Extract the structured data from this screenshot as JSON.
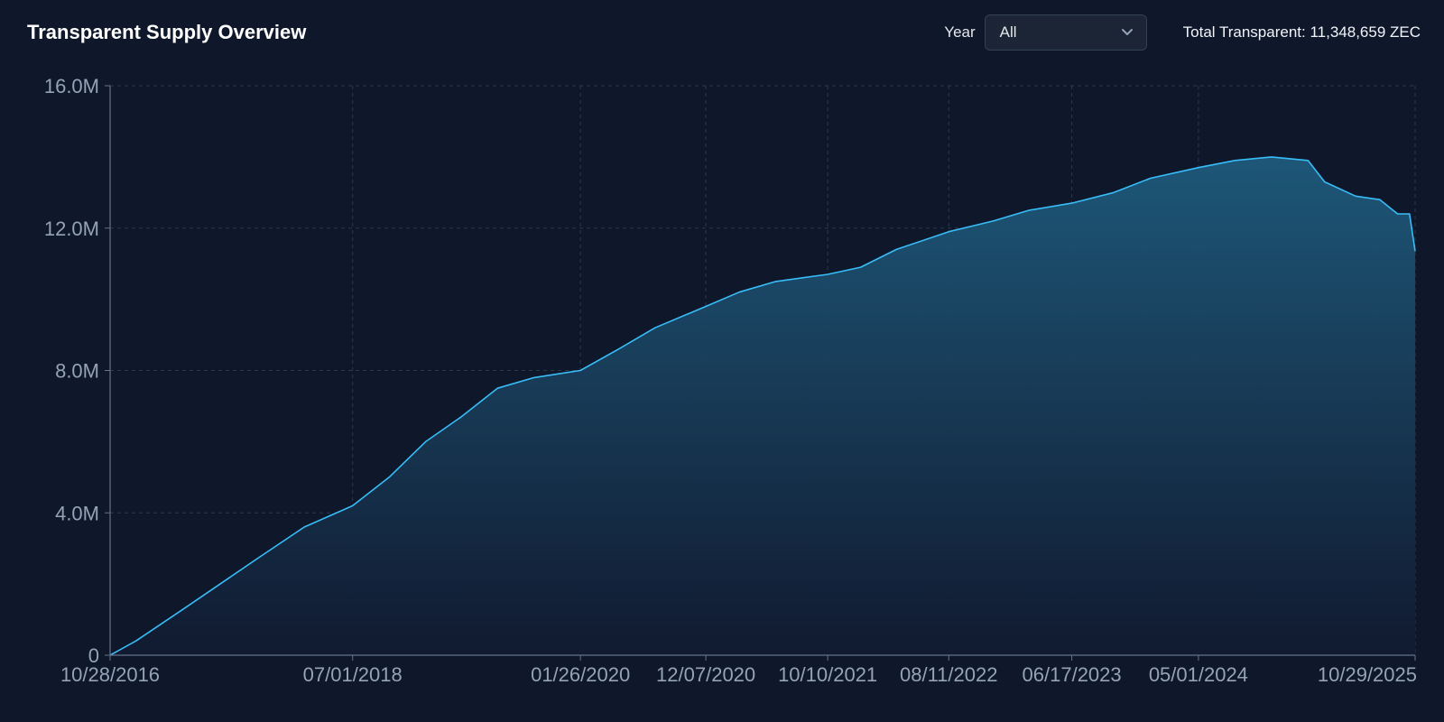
{
  "header": {
    "title": "Transparent Supply Overview",
    "year_label": "Year",
    "year_selected": "All",
    "total_text": "Total Transparent: 11,348,659 ZEC",
    "chevron_icon": "chevron-down-icon"
  },
  "colors": {
    "background": "#0f172a",
    "line": "#38bdf8",
    "area_top": "#1e5a7c",
    "area_bottom": "#111a30",
    "grid": "#334155",
    "tick_text": "#94a3b8"
  },
  "chart_data": {
    "type": "area",
    "title": "",
    "xlabel": "",
    "ylabel": "",
    "ylim": [
      0,
      16000000
    ],
    "x_range": [
      "2016-10-28",
      "2025-10-29"
    ],
    "y_ticks": [
      {
        "value": 0,
        "label": "0"
      },
      {
        "value": 4000000,
        "label": "4.0M"
      },
      {
        "value": 8000000,
        "label": "8.0M"
      },
      {
        "value": 12000000,
        "label": "12.0M"
      },
      {
        "value": 16000000,
        "label": "16.0M"
      }
    ],
    "x_ticks": [
      {
        "value": "2016-10-28",
        "label": "10/28/2016"
      },
      {
        "value": "2018-07-01",
        "label": "07/01/2018"
      },
      {
        "value": "2020-01-26",
        "label": "01/26/2020"
      },
      {
        "value": "2020-12-07",
        "label": "12/07/2020"
      },
      {
        "value": "2021-10-10",
        "label": "10/10/2021"
      },
      {
        "value": "2022-08-11",
        "label": "08/11/2022"
      },
      {
        "value": "2023-06-17",
        "label": "06/17/2023"
      },
      {
        "value": "2024-05-01",
        "label": "05/01/2024"
      },
      {
        "value": "2025-10-29",
        "label": "10/29/2025"
      }
    ],
    "grid": true,
    "series": [
      {
        "name": "",
        "points": [
          {
            "x": "2016-10-28",
            "y": 0
          },
          {
            "x": "2017-01-01",
            "y": 400000
          },
          {
            "x": "2017-05-01",
            "y": 1300000
          },
          {
            "x": "2017-11-01",
            "y": 2700000
          },
          {
            "x": "2018-03-01",
            "y": 3600000
          },
          {
            "x": "2018-07-01",
            "y": 4200000
          },
          {
            "x": "2018-10-01",
            "y": 5000000
          },
          {
            "x": "2019-01-01",
            "y": 6000000
          },
          {
            "x": "2019-04-01",
            "y": 6700000
          },
          {
            "x": "2019-07-01",
            "y": 7500000
          },
          {
            "x": "2019-10-01",
            "y": 7800000
          },
          {
            "x": "2020-01-26",
            "y": 8000000
          },
          {
            "x": "2020-05-01",
            "y": 8600000
          },
          {
            "x": "2020-08-01",
            "y": 9200000
          },
          {
            "x": "2020-12-07",
            "y": 9800000
          },
          {
            "x": "2021-03-01",
            "y": 10200000
          },
          {
            "x": "2021-06-01",
            "y": 10500000
          },
          {
            "x": "2021-10-10",
            "y": 10700000
          },
          {
            "x": "2022-01-01",
            "y": 10900000
          },
          {
            "x": "2022-04-01",
            "y": 11400000
          },
          {
            "x": "2022-08-11",
            "y": 11900000
          },
          {
            "x": "2022-12-01",
            "y": 12200000
          },
          {
            "x": "2023-03-01",
            "y": 12500000
          },
          {
            "x": "2023-06-17",
            "y": 12700000
          },
          {
            "x": "2023-10-01",
            "y": 13000000
          },
          {
            "x": "2024-01-01",
            "y": 13400000
          },
          {
            "x": "2024-05-01",
            "y": 13700000
          },
          {
            "x": "2024-08-01",
            "y": 13900000
          },
          {
            "x": "2024-11-01",
            "y": 14000000
          },
          {
            "x": "2025-02-01",
            "y": 13900000
          },
          {
            "x": "2025-03-15",
            "y": 13300000
          },
          {
            "x": "2025-06-01",
            "y": 12900000
          },
          {
            "x": "2025-08-01",
            "y": 12800000
          },
          {
            "x": "2025-09-15",
            "y": 12400000
          },
          {
            "x": "2025-10-15",
            "y": 12400000
          },
          {
            "x": "2025-10-29",
            "y": 11348659
          }
        ]
      }
    ]
  }
}
